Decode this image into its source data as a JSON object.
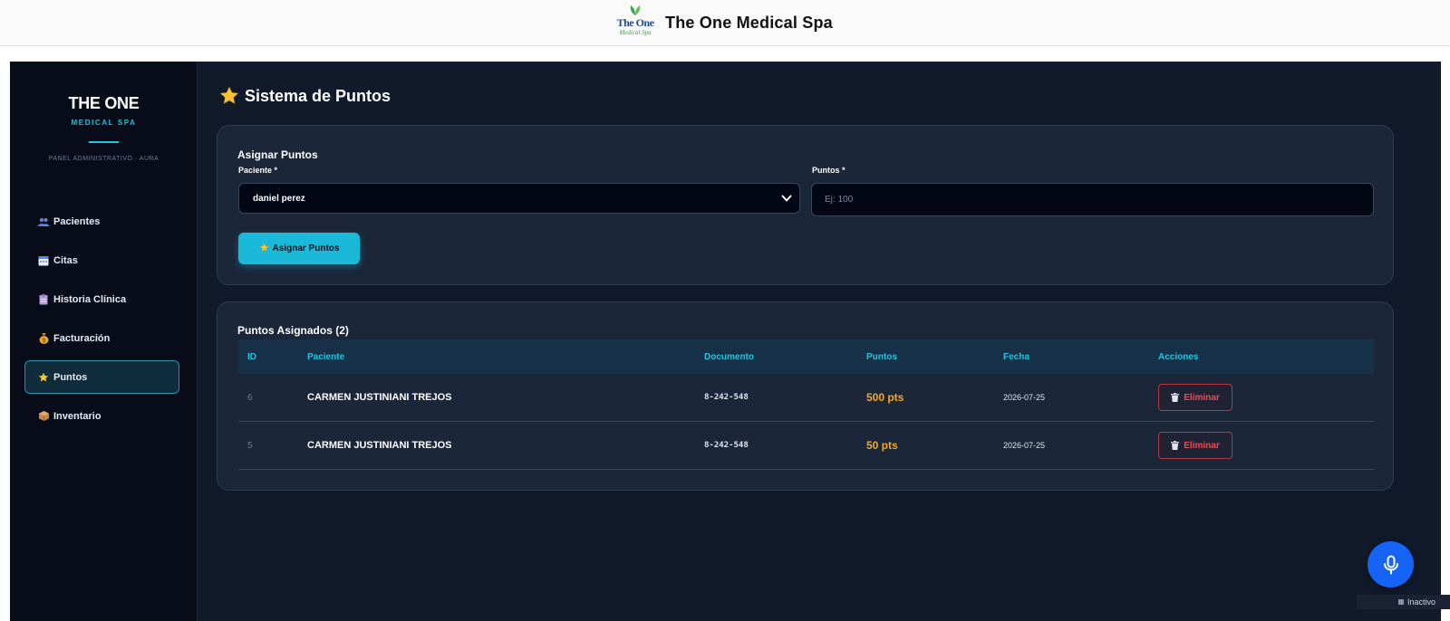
{
  "header": {
    "logo_text_1": "The One",
    "logo_text_2": "Medical Spa",
    "title": "The One Medical Spa"
  },
  "sidebar": {
    "title": "THE ONE",
    "subtitle": "MEDICAL SPA",
    "panel": "PANEL ADMINISTRATIVO · AURA",
    "items": [
      {
        "label": "Pacientes",
        "icon": "users-icon"
      },
      {
        "label": "Citas",
        "icon": "calendar-icon"
      },
      {
        "label": "Historia Clínica",
        "icon": "clipboard-icon"
      },
      {
        "label": "Facturación",
        "icon": "money-bag-icon"
      },
      {
        "label": "Puntos",
        "icon": "star-icon",
        "active": true
      },
      {
        "label": "Inventario",
        "icon": "box-icon"
      }
    ]
  },
  "page": {
    "title": "Sistema de Puntos"
  },
  "assign": {
    "title": "Asignar Puntos",
    "patient_label": "Paciente *",
    "patient_value": "daniel perez",
    "points_label": "Puntos *",
    "points_placeholder": "Ej: 100",
    "button": "Asignar Puntos"
  },
  "assigned": {
    "title": "Puntos Asignados (2)",
    "columns": [
      "ID",
      "Paciente",
      "Documento",
      "Puntos",
      "Fecha",
      "Acciones"
    ],
    "rows": [
      {
        "id": "6",
        "patient": "CARMEN JUSTINIANI TREJOS",
        "document": "8-242-548",
        "points": "500 pts",
        "date": "2026-07-25",
        "action": "Eliminar"
      },
      {
        "id": "5",
        "patient": "CARMEN JUSTINIANI TREJOS",
        "document": "8-242-548",
        "points": "50 pts",
        "date": "2026-07-25",
        "action": "Eliminar"
      }
    ]
  },
  "status": {
    "label": "Inactivo"
  },
  "colors": {
    "accent": "#1ab9d8",
    "points": "#f6a823",
    "danger": "#ef4a55",
    "mic": "#1664f5"
  }
}
